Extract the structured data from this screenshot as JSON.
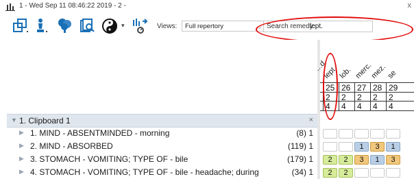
{
  "window": {
    "title": "1 - Wed Sep 11 08:46:22 2019 - 2 -",
    "close": "x"
  },
  "toolbar": {
    "views_label": "Views:",
    "views_value": "Full repertory",
    "search_label": "Search remedy:",
    "search_value": "lept."
  },
  "remedies": {
    "labels": [
      "...d",
      "lept.",
      "lob.",
      "merc.",
      "mez.",
      "se"
    ],
    "numbers": [
      "25",
      "26",
      "27",
      "28",
      "29"
    ],
    "row2": [
      "2",
      "2",
      "2",
      "2",
      "2"
    ],
    "row3": [
      "4",
      "4",
      "4",
      "4",
      "4"
    ]
  },
  "clipboard": {
    "title": "1. Clipboard 1",
    "close": "×",
    "rubrics": [
      {
        "text": "1. MIND - ABSENTMINDED - morning",
        "count": "(8) 1",
        "cells": [
          "",
          "",
          "",
          "",
          ""
        ]
      },
      {
        "text": "2. MIND - ABSORBED",
        "count": "(119) 1",
        "cells": [
          "",
          "",
          "1",
          "3",
          "1"
        ]
      },
      {
        "text": "3. STOMACH - VOMITING; TYPE OF - bile",
        "count": "(179) 1",
        "cells": [
          "2",
          "2",
          "3",
          "1",
          "3"
        ]
      },
      {
        "text": "4. STOMACH - VOMITING; TYPE OF - bile - headache; during",
        "count": "(34) 1",
        "cells": [
          "2",
          "2",
          "",
          "",
          ""
        ]
      }
    ]
  },
  "colors": {
    "accent_red": "#e20a0a",
    "grade1": "#b9cfe6",
    "grade2": "#d7ec9a",
    "grade3": "#f1c77c"
  }
}
